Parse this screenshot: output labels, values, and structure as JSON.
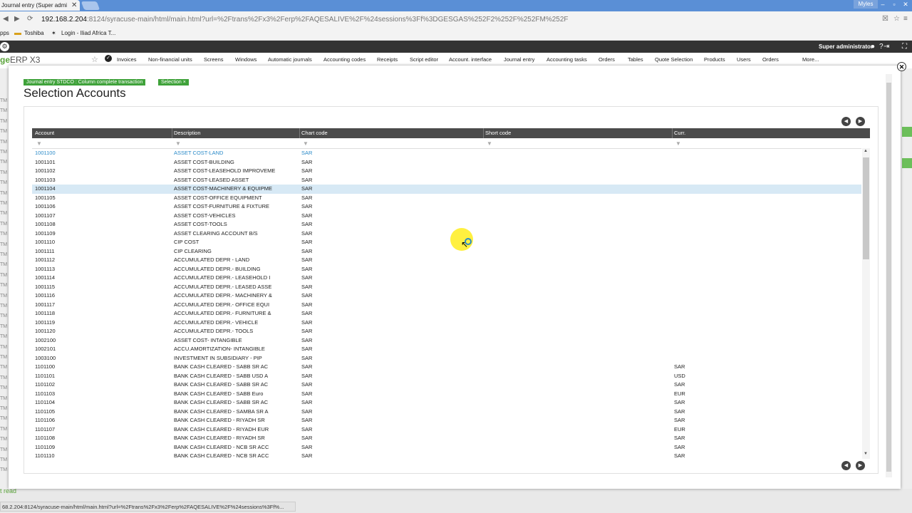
{
  "browser": {
    "tab_title": "Journal entry (Super admi",
    "tab_close": "✕",
    "window_user": "Myles",
    "address_host": "192.168.2.204",
    "address_rest": ":8124/syracuse-main/html/main.html?url=%2Ftrans%2Fx3%2Ferp%2FAQESALIVE%2F%24sessions%3Ff%3DGESGAS%252F2%252F%252FM%252F",
    "bookmarks": [
      "pps",
      "Toshiba",
      "Login - Iliad Africa T..."
    ],
    "status_url": "68.2.204:8124/syracuse-main/html/main.html?url=%2Ftrans%2Fx3%2Ferp%2FAQESALIVE%2F%24sessions%3Ff%..."
  },
  "app": {
    "brand_green": "ge",
    "brand_rest": "ERP X3",
    "user": "Super administrator",
    "menu": [
      "Invoices",
      "Non-financial units",
      "Screens",
      "Windows",
      "Automatic journals",
      "Accounting codes",
      "Receipts",
      "Script editor",
      "Account. interface",
      "Journal entry",
      "Accounting tasks",
      "Orders",
      "Tables",
      "Quote Selection",
      "Products",
      "Users",
      "Orders",
      "More..."
    ],
    "left_strip": [
      "TM",
      "TM",
      "TM",
      "TM",
      "TM",
      "TM",
      "TM",
      "TM",
      "TM",
      "TM",
      "TM",
      "TM",
      "TM",
      "TM",
      "TM",
      "TM",
      "TM",
      "TM",
      "TM",
      "TM",
      "TM",
      "TM",
      "TM",
      "TM",
      "TM",
      "TM",
      "TM",
      "TM",
      "TM",
      "TM",
      "TM",
      "TM",
      "TM",
      "TM",
      "TM",
      "TM",
      "TM"
    ],
    "bottom_left": "t read"
  },
  "modal": {
    "breadcrumb_1": "Journal entry STDCO : Column complete transaction",
    "breadcrumb_2": "Selection ×",
    "title": "Selection Accounts",
    "close": "✕",
    "columns": [
      "Account",
      "Description",
      "Chart code",
      "Short code",
      "Curr."
    ],
    "rows": [
      [
        "1001100",
        "ASSET COST-LAND",
        "SAR",
        ""
      ],
      [
        "1001101",
        "ASSET COST-BUILDING",
        "SAR",
        ""
      ],
      [
        "1001102",
        "ASSET COST-LEASEHOLD IMPROVEME",
        "SAR",
        ""
      ],
      [
        "1001103",
        "ASSET COST-LEASED ASSET",
        "SAR",
        ""
      ],
      [
        "1001104",
        "ASSET COST-MACHINERY & EQUIPME",
        "SAR",
        ""
      ],
      [
        "1001105",
        "ASSET COST-OFFICE EQUIPMENT",
        "SAR",
        ""
      ],
      [
        "1001106",
        "ASSET COST-FURNITURE & FIXTURE",
        "SAR",
        ""
      ],
      [
        "1001107",
        "ASSET COST-VEHICLES",
        "SAR",
        ""
      ],
      [
        "1001108",
        "ASSET COST-TOOLS",
        "SAR",
        ""
      ],
      [
        "1001109",
        "ASSET CLEARING ACCOUNT B/S",
        "SAR",
        ""
      ],
      [
        "1001110",
        "CIP COST",
        "SAR",
        ""
      ],
      [
        "1001111",
        "CIP CLEARING",
        "SAR",
        ""
      ],
      [
        "1001112",
        "ACCUMULATED DEPR - LAND",
        "SAR",
        ""
      ],
      [
        "1001113",
        "ACCUMULATED DEPR.- BUILDING",
        "SAR",
        ""
      ],
      [
        "1001114",
        "ACCUMULATED DEPR.- LEASEHOLD I",
        "SAR",
        ""
      ],
      [
        "1001115",
        "ACCUMULATED DEPR.- LEASED ASSE",
        "SAR",
        ""
      ],
      [
        "1001116",
        "ACCUMULATED DEPR.- MACHINERY &",
        "SAR",
        ""
      ],
      [
        "1001117",
        "ACCUMULATED DEPR.- OFFICE EQUI",
        "SAR",
        ""
      ],
      [
        "1001118",
        "ACCUMULATED DEPR.- FURNITURE &",
        "SAR",
        ""
      ],
      [
        "1001119",
        "ACCUMULATED DEPR.- VEHICLE",
        "SAR",
        ""
      ],
      [
        "1001120",
        "ACCUMULATED DEPR.- TOOLS",
        "SAR",
        ""
      ],
      [
        "1002100",
        "ASSET COST- INTANGIBLE",
        "SAR",
        ""
      ],
      [
        "1002101",
        "ACCU.AMORTIZATION- INTANGIBLE",
        "SAR",
        ""
      ],
      [
        "1003100",
        "INVESTMENT IN SUBSIDIARY - PIP",
        "SAR",
        ""
      ],
      [
        "1101100",
        "BANK CASH CLEARED - SABB SR AC",
        "SAR",
        "SAR"
      ],
      [
        "1101101",
        "BANK CASH CLEARED - SABB USD A",
        "SAR",
        "USD"
      ],
      [
        "1101102",
        "BANK CASH CLEARED - SABB SR AC",
        "SAR",
        "SAR"
      ],
      [
        "1101103",
        "BANK CASH CLEARED - SABB Euro",
        "SAR",
        "EUR"
      ],
      [
        "1101104",
        "BANK CASH CLEARED - SABB SR AC",
        "SAR",
        "SAR"
      ],
      [
        "1101105",
        "BANK CASH CLEARED - SAMBA SR A",
        "SAR",
        "SAR"
      ],
      [
        "1101106",
        "BANK CASH CLEARED - RIYADH SR",
        "SAR",
        "SAR"
      ],
      [
        "1101107",
        "BANK CASH CLEARED - RIYADH EUR",
        "SAR",
        "EUR"
      ],
      [
        "1101108",
        "BANK CASH CLEARED - RIYADH SR",
        "SAR",
        "SAR"
      ],
      [
        "1101109",
        "BANK CASH CLEARED - NCB SR ACC",
        "SAR",
        "SAR"
      ],
      [
        "1101110",
        "BANK CASH CLEARED - NCB SR ACC",
        "SAR",
        "SAR"
      ]
    ],
    "selected_row": 4
  }
}
